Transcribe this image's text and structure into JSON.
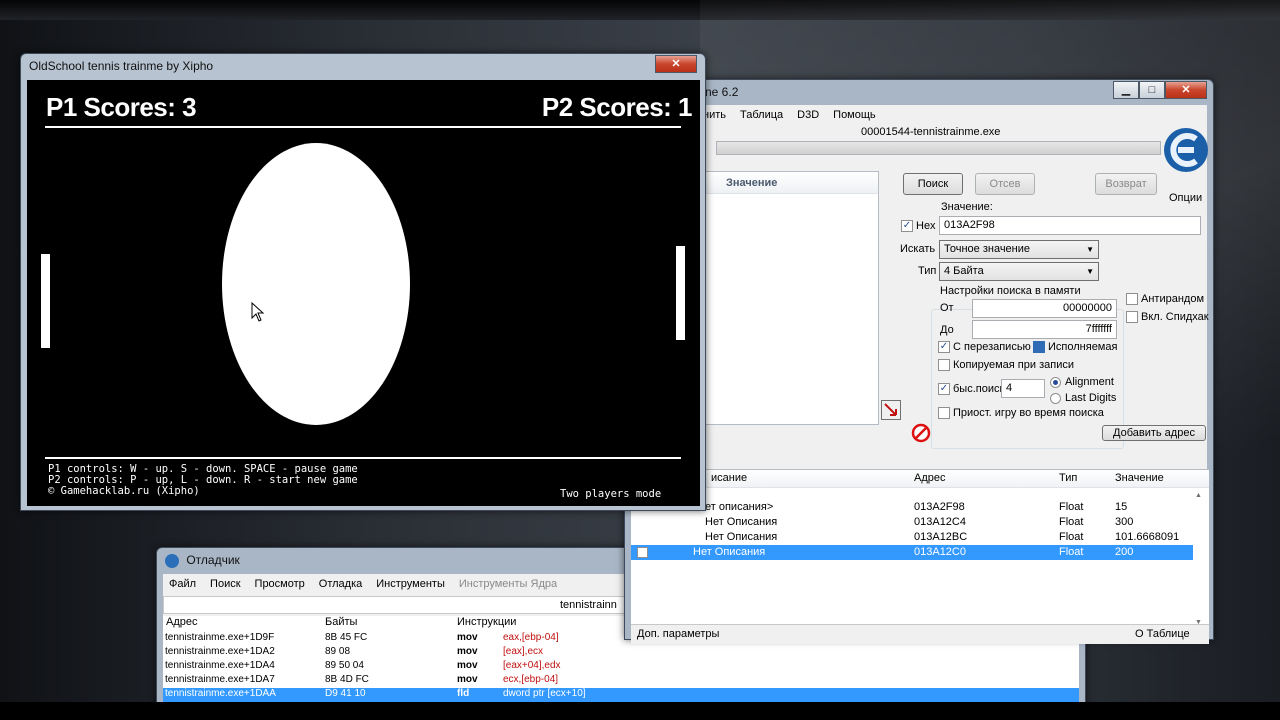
{
  "game": {
    "title": "OldSchool tennis trainme by Xipho",
    "p1_score_label": "P1 Scores:  3",
    "p2_score_label": "P2 Scores:  1",
    "controls_line1": "P1 controls: W - up. S - down. SPACE - pause game",
    "controls_line2": "P2 controls: P - up, L - down. R - start new game",
    "credit": "© Gamehacklab.ru (Xipho)",
    "mode": "Two players mode",
    "close_glyph": "✕"
  },
  "cheatengine": {
    "title": "ne 6.2",
    "caption": {
      "min": "▁",
      "max": "□",
      "close": "✕"
    },
    "menu": [
      "нить",
      "Таблица",
      "D3D",
      "Помощь"
    ],
    "process": "00001544-tennistrainme.exe",
    "found_header": "Значение",
    "buttons": {
      "search": "Поиск",
      "sift": "Отсев",
      "undo": "Возврат",
      "add_address": "Добавить адрес"
    },
    "options_label": "Опции",
    "value_label": "Значение:",
    "hex_label": "Hex",
    "hex_checked": true,
    "value_input": "013A2F98",
    "scan_type_label": "Искать",
    "scan_type": "Точное значение",
    "value_type_label": "Тип",
    "value_type": "4 Байта",
    "memory_group_label": "Настройки поиска в памяти",
    "from_label": "От",
    "from_value": "00000000",
    "to_label": "До",
    "to_value": "7fffffff",
    "antirandom": "Антирандом",
    "speedhack": "Вкл. Спидхак",
    "writable": "С перезаписью",
    "executable": "Исполняемая",
    "copy_on_write": "Копируемая при записи",
    "fast_scan": "быс.поиск",
    "fast_scan_value": "4",
    "alignment": "Alignment",
    "last_digits": "Last Digits",
    "pause_game": "Приост. игру во время поиска",
    "columns": {
      "desc": "исание",
      "address": "Адрес",
      "type": "Тип",
      "value": "Значение"
    },
    "rows": [
      {
        "desc": "ет описания>",
        "address": "013A2F98",
        "type": "Float",
        "value": "15",
        "selected": false
      },
      {
        "desc": "Нет Описания",
        "address": "013A12C4",
        "type": "Float",
        "value": "300",
        "selected": false
      },
      {
        "desc": "Нет Описания",
        "address": "013A12BC",
        "type": "Float",
        "value": "101.6668091",
        "selected": false
      },
      {
        "desc": "Нет Описания",
        "address": "013A12C0",
        "type": "Float",
        "value": "200",
        "selected": true
      }
    ],
    "status_left": "Доп. параметры",
    "status_right": "О Таблице",
    "scroll_up": "▲",
    "scroll_down": "▼",
    "combo_arrow": "▼",
    "checkmark": "✓"
  },
  "debugger": {
    "title": "Отладчик",
    "menu": [
      {
        "label": "Файл",
        "disabled": false
      },
      {
        "label": "Поиск",
        "disabled": false
      },
      {
        "label": "Просмотр",
        "disabled": false
      },
      {
        "label": "Отладка",
        "disabled": false
      },
      {
        "label": "Инструменты",
        "disabled": false
      },
      {
        "label": "Инструменты Ядра",
        "disabled": true
      }
    ],
    "process": "tennistrainn",
    "columns": {
      "address": "Адрес",
      "bytes": "Байты",
      "instr": "Инструкции"
    },
    "rows": [
      {
        "address": "tennistrainme.exe+1D9F",
        "bytes": "8B 45 FC",
        "mnemonic": "mov",
        "operand": "eax,[ebp-04]"
      },
      {
        "address": "tennistrainme.exe+1DA2",
        "bytes": "89 08",
        "mnemonic": "mov",
        "operand": "[eax],ecx"
      },
      {
        "address": "tennistrainme.exe+1DA4",
        "bytes": "89 50 04",
        "mnemonic": "mov",
        "operand": "[eax+04],edx"
      },
      {
        "address": "tennistrainme.exe+1DA7",
        "bytes": "8B 4D FC",
        "mnemonic": "mov",
        "operand": "ecx,[ebp-04]"
      },
      {
        "address": "tennistrainme.exe+1DAA",
        "bytes": "D9 41 10",
        "mnemonic": "fld",
        "operand": "dword ptr [ecx+10]"
      }
    ]
  }
}
